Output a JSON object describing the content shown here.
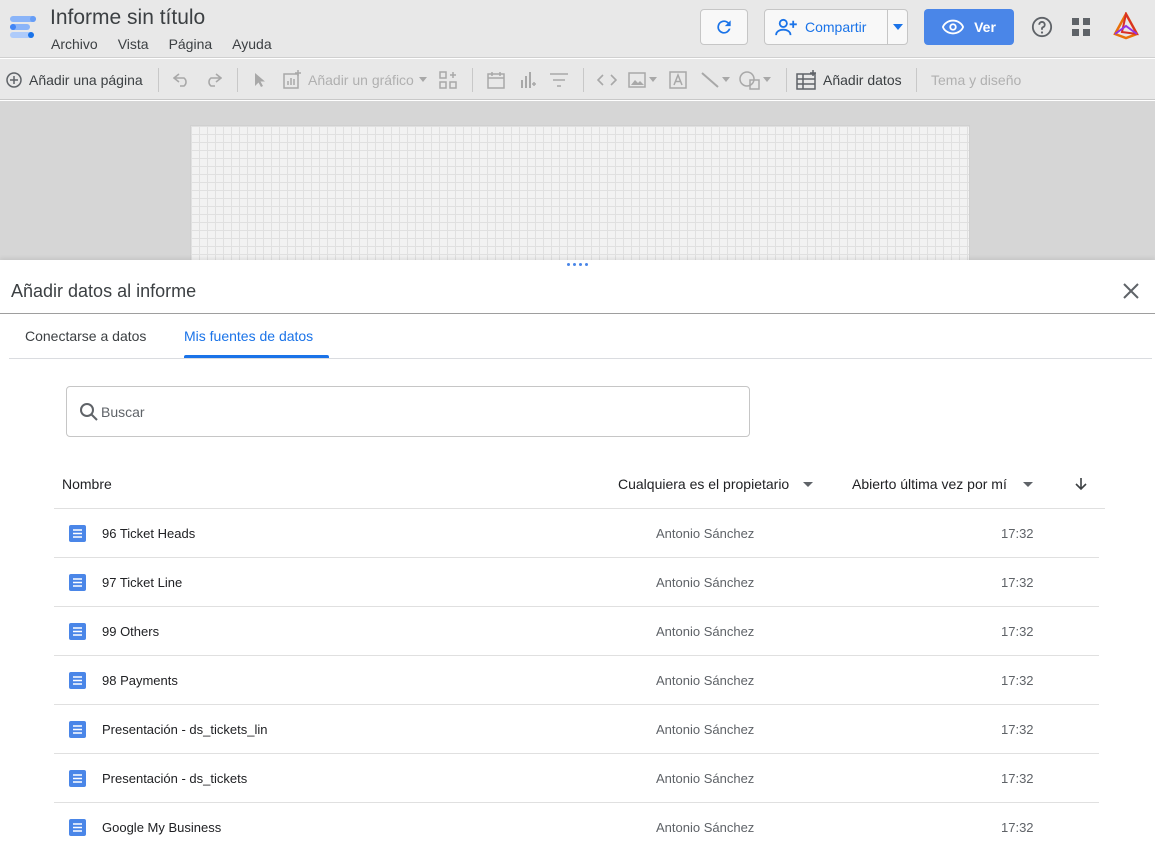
{
  "header": {
    "title": "Informe sin título",
    "menu": [
      "Archivo",
      "Vista",
      "Página",
      "Ayuda"
    ],
    "share_label": "Compartir",
    "view_label": "Ver",
    "accent": "#4a86e8"
  },
  "toolbar": {
    "add_page": "Añadir una página",
    "add_chart": "Añadir un gráfico",
    "add_data": "Añadir datos",
    "theme": "Tema y diseño"
  },
  "panel": {
    "title": "Añadir datos al informe",
    "tabs": [
      "Conectarse a datos",
      "Mis fuentes de datos"
    ],
    "active_tab": "Mis fuentes de datos",
    "search_placeholder": "Buscar",
    "columns": {
      "name": "Nombre",
      "owner": "Cualquiera es el propietario",
      "opened": "Abierto última vez por mí"
    },
    "rows": [
      {
        "name": "96 Ticket Heads",
        "owner": "Antonio Sánchez",
        "time": "17:32"
      },
      {
        "name": "97 Ticket Line",
        "owner": "Antonio Sánchez",
        "time": "17:32"
      },
      {
        "name": "99 Others",
        "owner": "Antonio Sánchez",
        "time": "17:32"
      },
      {
        "name": "98 Payments",
        "owner": "Antonio Sánchez",
        "time": "17:32"
      },
      {
        "name": "Presentación - ds_tickets_lin",
        "owner": "Antonio Sánchez",
        "time": "17:32"
      },
      {
        "name": "Presentación - ds_tickets",
        "owner": "Antonio Sánchez",
        "time": "17:32"
      },
      {
        "name": "Google My Business",
        "owner": "Antonio Sánchez",
        "time": "17:32"
      }
    ]
  }
}
